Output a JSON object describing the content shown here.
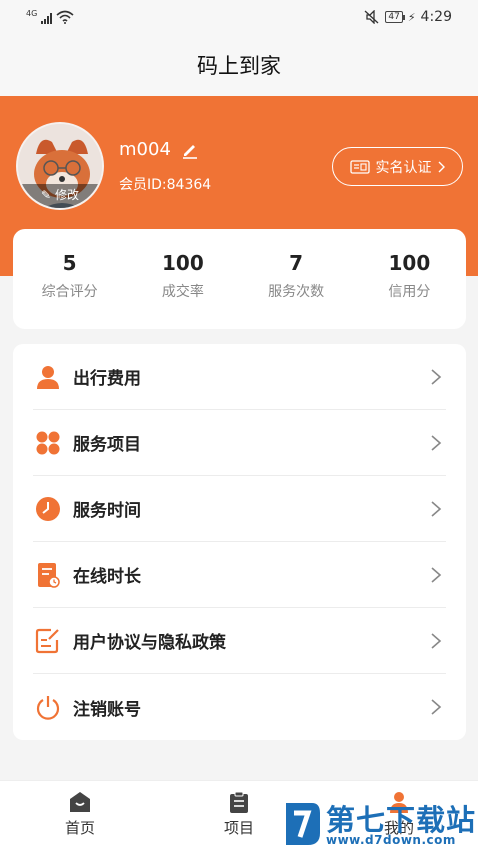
{
  "status_bar": {
    "network": "4G",
    "battery": "47",
    "time": "4:29"
  },
  "header": {
    "title": "码上到家"
  },
  "profile": {
    "avatar_edit_label": "修改",
    "username": "m004",
    "member_id": "会员ID:84364",
    "verify_label": "实名认证"
  },
  "stats": [
    {
      "value": "5",
      "label": "综合评分"
    },
    {
      "value": "100",
      "label": "成交率"
    },
    {
      "value": "7",
      "label": "服务次数"
    },
    {
      "value": "100",
      "label": "信用分"
    }
  ],
  "menu": [
    {
      "label": "出行费用",
      "icon": "person-icon"
    },
    {
      "label": "服务项目",
      "icon": "grid-icon"
    },
    {
      "label": "服务时间",
      "icon": "clock-icon"
    },
    {
      "label": "在线时长",
      "icon": "document-icon"
    },
    {
      "label": "用户协议与隐私政策",
      "icon": "edit-document-icon"
    },
    {
      "label": "注销账号",
      "icon": "power-icon"
    }
  ],
  "bottom_nav": [
    {
      "label": "首页",
      "icon": "home-icon"
    },
    {
      "label": "项目",
      "icon": "clipboard-icon"
    },
    {
      "label": "我的",
      "icon": "user-icon"
    }
  ],
  "watermark": {
    "title": "第七下载站",
    "url": "www.d7down.com"
  },
  "colors": {
    "accent": "#f07335",
    "watermark": "#1d6fb7"
  }
}
